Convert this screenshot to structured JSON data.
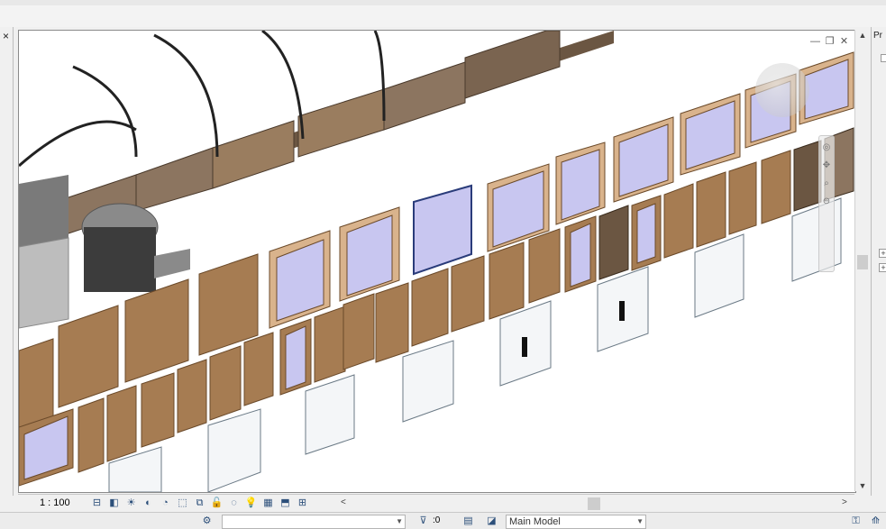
{
  "view": {
    "scale": "1 : 100",
    "window_buttons": [
      "—",
      "❐",
      "✕"
    ]
  },
  "left_panel": {
    "close_label": "×"
  },
  "properties_panel": {
    "tab_label": "Pr"
  },
  "view_control_bar": {
    "icons": [
      "detail-level-icon",
      "visual-style-icon",
      "sun-path-icon",
      "shadows-icon",
      "render-icon",
      "crop-view-icon",
      "show-crop-icon",
      "unlock-3d-view-icon",
      "temporary-hide-icon",
      "reveal-hidden-icon",
      "analytical-model-icon",
      "highlight-displacement-icon",
      "show-constraints-icon"
    ],
    "glyphs": [
      "⊟",
      "◧",
      "☀",
      "◐",
      "◔",
      "⬚",
      "⧉",
      "🔓",
      "◌",
      "💡",
      "▦",
      "⬒",
      "⊞"
    ],
    "scroll_left": "<",
    "scroll_right": ">"
  },
  "status_bar": {
    "workset_value": "",
    "selection_count": ":0",
    "model": "Main Model"
  },
  "colors": {
    "door_wood": "#a67c52",
    "door_frame": "#d9b38c",
    "glass": "#c8c6f0",
    "wall": "#8c7560",
    "roof": "#2b2b2b"
  }
}
